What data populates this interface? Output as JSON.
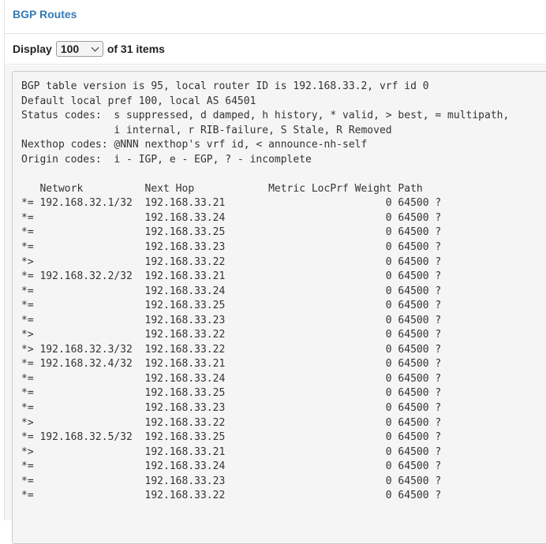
{
  "panel": {
    "title": "BGP Routes"
  },
  "toolbar": {
    "display_label": "Display",
    "page_size": "100",
    "count_text": "of 31 items"
  },
  "output": {
    "header_lines": [
      "BGP table version is 95, local router ID is 192.168.33.2, vrf id 0",
      "Default local pref 100, local AS 64501",
      "Status codes:  s suppressed, d damped, h history, * valid, > best, = multipath,",
      "               i internal, r RIB-failure, S Stale, R Removed",
      "Nexthop codes: @NNN nexthop's vrf id, < announce-nh-self",
      "Origin codes:  i - IGP, e - EGP, ? - incomplete",
      ""
    ],
    "column_header": "   Network          Next Hop            Metric LocPrf Weight Path",
    "routes": [
      "*= 192.168.32.1/32  192.168.33.21                          0 64500 ?",
      "*=                  192.168.33.24                          0 64500 ?",
      "*=                  192.168.33.25                          0 64500 ?",
      "*=                  192.168.33.23                          0 64500 ?",
      "*>                  192.168.33.22                          0 64500 ?",
      "*= 192.168.32.2/32  192.168.33.21                          0 64500 ?",
      "*=                  192.168.33.24                          0 64500 ?",
      "*=                  192.168.33.25                          0 64500 ?",
      "*=                  192.168.33.23                          0 64500 ?",
      "*>                  192.168.33.22                          0 64500 ?",
      "*> 192.168.32.3/32  192.168.33.22                          0 64500 ?",
      "*= 192.168.32.4/32  192.168.33.21                          0 64500 ?",
      "*=                  192.168.33.24                          0 64500 ?",
      "*=                  192.168.33.25                          0 64500 ?",
      "*=                  192.168.33.23                          0 64500 ?",
      "*>                  192.168.33.22                          0 64500 ?",
      "*= 192.168.32.5/32  192.168.33.25                          0 64500 ?",
      "*>                  192.168.33.21                          0 64500 ?",
      "*=                  192.168.33.24                          0 64500 ?",
      "*=                  192.168.33.23                          0 64500 ?",
      "*=                  192.168.33.22                          0 64500 ?"
    ]
  }
}
